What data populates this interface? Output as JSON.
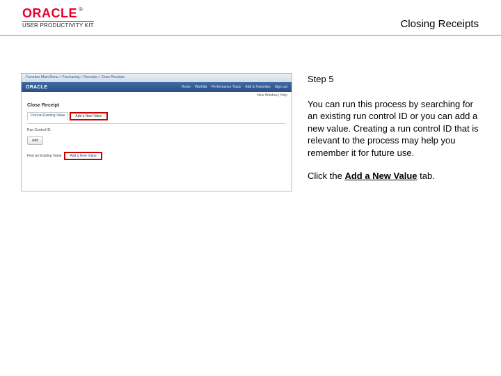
{
  "header": {
    "logo_text": "ORACLE",
    "logo_tm": "®",
    "logo_sub": "USER PRODUCTIVITY KIT",
    "title": "Closing Receipts"
  },
  "instructions": {
    "step_label": "Step 5",
    "paragraph": "You can run this process by searching for an existing run control ID or you can add a new value. Creating a run control ID that is relevant to the process may help you remember it for future use.",
    "action_prefix": "Click the ",
    "action_target": "Add a New Value",
    "action_suffix": " tab."
  },
  "screenshot": {
    "topbar": "Favorites   Main Menu > Purchasing > Receipts > Close Receipts",
    "brand": "ORACLE",
    "nav": {
      "home": "Home",
      "worklist": "Worklist",
      "perf": "Performance Trace",
      "add_fav": "Add to Favorites",
      "signout": "Sign out"
    },
    "subbar": "New Window | Help",
    "heading": "Close Receipt",
    "tab_find": "Find an Existing Value",
    "tab_add": "Add a New Value",
    "field_label": "Run Control ID:",
    "add_button": "Add",
    "find_prefix": "Find an Existing Value",
    "find_link": "Add a New Value"
  }
}
